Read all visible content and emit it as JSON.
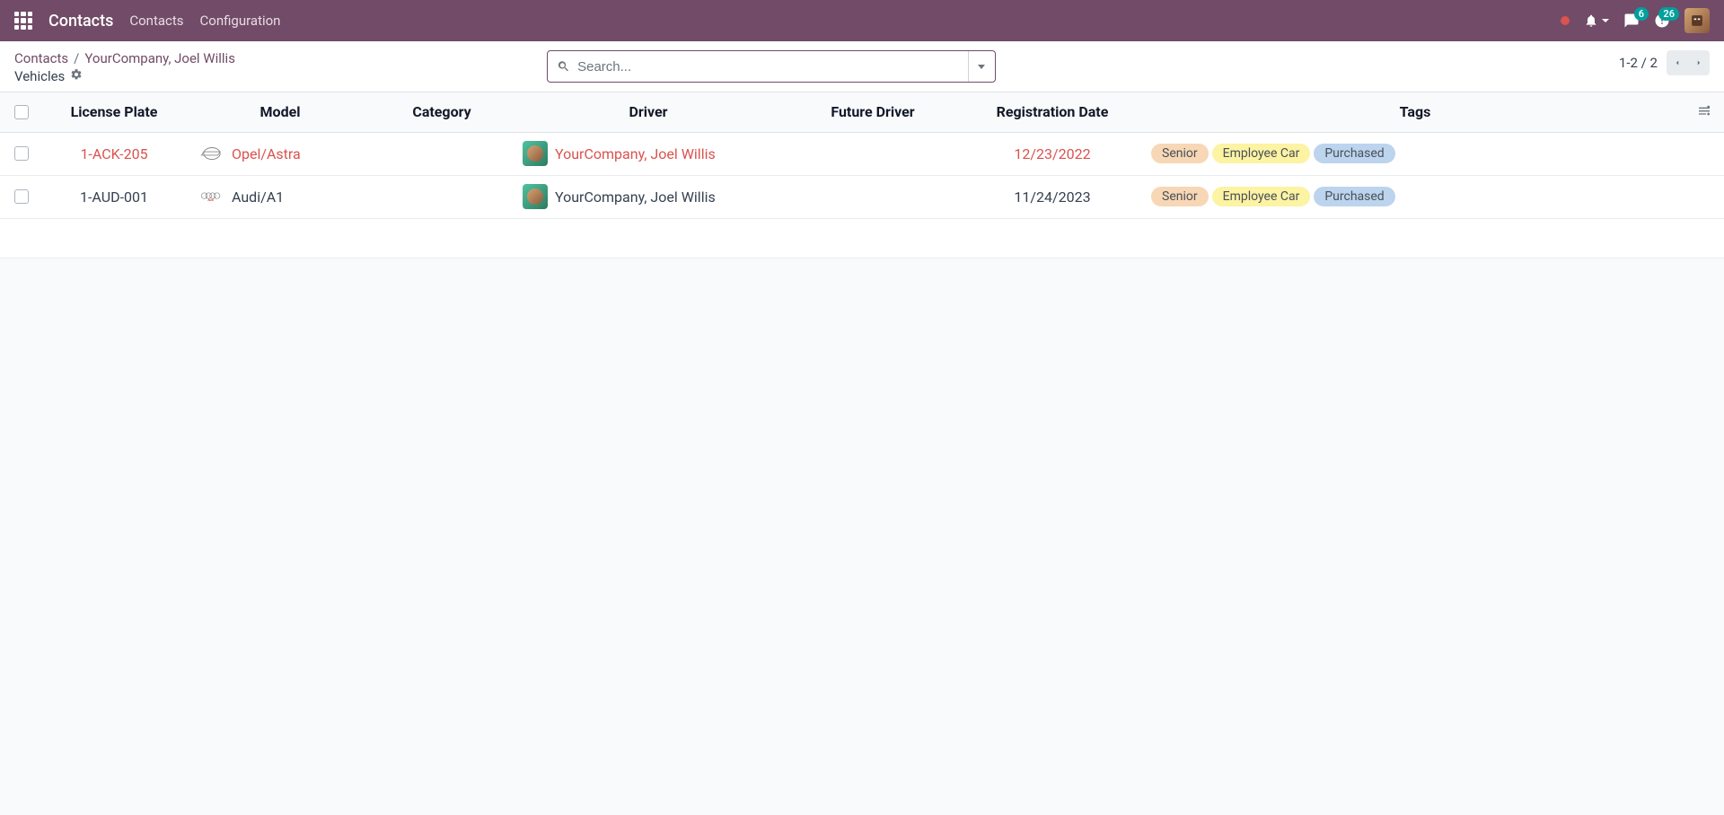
{
  "nav": {
    "brand": "Contacts",
    "menu1": "Contacts",
    "menu2": "Configuration",
    "badge_messages": "6",
    "badge_activities": "26"
  },
  "breadcrumb": {
    "root": "Contacts",
    "current": "YourCompany, Joel Willis",
    "subtitle": "Vehicles"
  },
  "search": {
    "placeholder": "Search..."
  },
  "pager": {
    "text": "1-2 / 2"
  },
  "columns": {
    "plate": "License Plate",
    "model": "Model",
    "category": "Category",
    "driver": "Driver",
    "future": "Future Driver",
    "date": "Registration Date",
    "tags": "Tags"
  },
  "rows": [
    {
      "plate": "1-ACK-205",
      "model": "Opel/Astra",
      "brand": "opel",
      "driver": "YourCompany, Joel Willis",
      "future": "",
      "date": "12/23/2022",
      "danger": true,
      "tags": [
        "Senior",
        "Employee Car",
        "Purchased"
      ]
    },
    {
      "plate": "1-AUD-001",
      "model": "Audi/A1",
      "brand": "audi",
      "driver": "YourCompany, Joel Willis",
      "future": "",
      "date": "11/24/2023",
      "danger": false,
      "tags": [
        "Senior",
        "Employee Car",
        "Purchased"
      ]
    }
  ],
  "tags_map": {
    "Senior": "tag-senior",
    "Employee Car": "tag-emp",
    "Purchased": "tag-purch"
  }
}
